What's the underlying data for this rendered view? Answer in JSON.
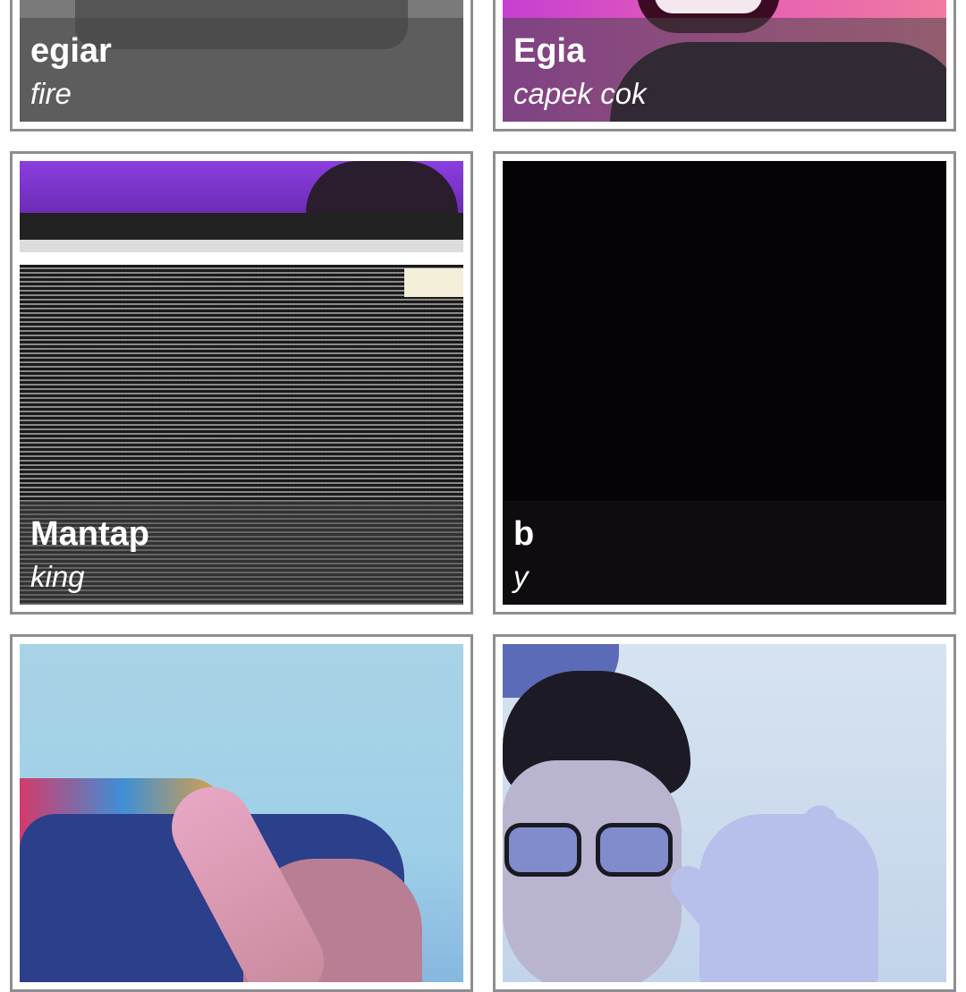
{
  "participants": [
    {
      "name": "egiar",
      "subtitle": "fire"
    },
    {
      "name": "Egia",
      "subtitle": "capek cok"
    },
    {
      "name": "Mantap",
      "subtitle": "king"
    },
    {
      "name": "b",
      "subtitle": "y"
    },
    {
      "name": "",
      "subtitle": ""
    },
    {
      "name": "",
      "subtitle": ""
    }
  ],
  "colors": {
    "card_border": "#8e8e92",
    "caption_overlay": "rgba(70,70,70,0.55)",
    "caption_text": "#ffffff",
    "background": "#ffffff"
  }
}
